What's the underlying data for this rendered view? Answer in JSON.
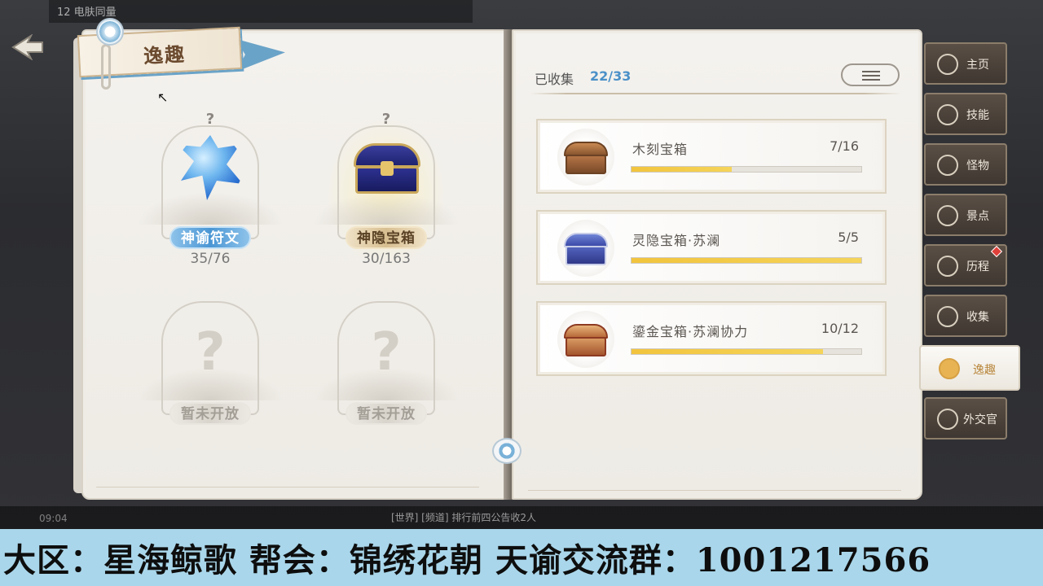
{
  "background": {
    "top_text": "12 电肤同量",
    "bottom_text": "[世界] [频道] 排行前四公告收2人",
    "time": "09:04"
  },
  "header": {
    "title": "逸趣"
  },
  "categories": [
    {
      "label": "神谕符文",
      "count": "35/76",
      "hint": "?",
      "state": "active"
    },
    {
      "label": "神隐宝箱",
      "count": "30/163",
      "hint": "?",
      "state": "gold"
    },
    {
      "label": "暂未开放",
      "count": "",
      "hint": "?",
      "state": "locked"
    },
    {
      "label": "暂未开放",
      "count": "",
      "hint": "?",
      "state": "locked"
    }
  ],
  "collection": {
    "label": "已收集",
    "value": "22/33"
  },
  "items": [
    {
      "name": "木刻宝箱",
      "count": "7/16",
      "progress": 0.4375,
      "icon": "wooden-chest-icon"
    },
    {
      "name": "灵隐宝箱·苏澜",
      "count": "5/5",
      "progress": 1.0,
      "icon": "spirit-chest-icon"
    },
    {
      "name": "鎏金宝箱·苏澜协力",
      "count": "10/12",
      "progress": 0.8333,
      "icon": "gilded-chest-icon"
    }
  ],
  "tabs": [
    {
      "label": "主页",
      "icon": "home-icon"
    },
    {
      "label": "技能",
      "icon": "skill-icon"
    },
    {
      "label": "怪物",
      "icon": "monster-icon"
    },
    {
      "label": "景点",
      "icon": "landmark-icon"
    },
    {
      "label": "历程",
      "icon": "journey-icon",
      "badge": true
    },
    {
      "label": "收集",
      "icon": "collection-icon"
    },
    {
      "label": "逸趣",
      "icon": "fun-icon",
      "active": true
    },
    {
      "label": "外交官",
      "icon": "diplomat-icon"
    }
  ],
  "banner": {
    "text": "大区：星海鲸歌 帮会：锦绣花朝 天谕交流群：1001217566"
  },
  "colors": {
    "accent_blue": "#4a90c8",
    "progress_yellow": "#f2c43d",
    "banner_bg": "#a9d6ea",
    "badge_red": "#e0403a"
  }
}
